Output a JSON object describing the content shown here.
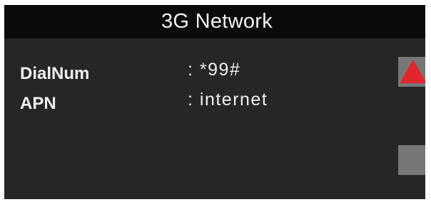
{
  "header": {
    "title": "3G Network"
  },
  "fields": [
    {
      "label": "DialNum",
      "value": ": *99#"
    },
    {
      "label": "APN",
      "value": ": internet"
    }
  ],
  "scroll": {
    "up_icon": "triangle-up-icon",
    "up_color": "#e2262b",
    "button_color": "#777777"
  },
  "colors": {
    "screen_bg": "#262626",
    "header_bg": "#0a0a0a",
    "text": "#f0f0f0"
  }
}
